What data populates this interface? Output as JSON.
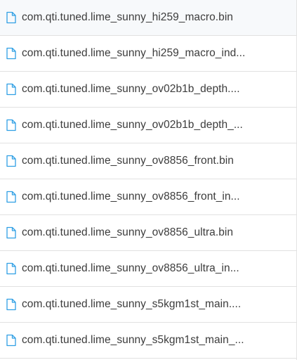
{
  "files": [
    {
      "name": "com.qti.tuned.lime_sunny_hi259_macro.bin",
      "icon": "file-icon"
    },
    {
      "name": "com.qti.tuned.lime_sunny_hi259_macro_ind...",
      "icon": "file-icon"
    },
    {
      "name": "com.qti.tuned.lime_sunny_ov02b1b_depth....",
      "icon": "file-icon"
    },
    {
      "name": "com.qti.tuned.lime_sunny_ov02b1b_depth_...",
      "icon": "file-icon"
    },
    {
      "name": "com.qti.tuned.lime_sunny_ov8856_front.bin",
      "icon": "file-icon"
    },
    {
      "name": "com.qti.tuned.lime_sunny_ov8856_front_in...",
      "icon": "file-icon"
    },
    {
      "name": "com.qti.tuned.lime_sunny_ov8856_ultra.bin",
      "icon": "file-icon"
    },
    {
      "name": "com.qti.tuned.lime_sunny_ov8856_ultra_in...",
      "icon": "file-icon"
    },
    {
      "name": "com.qti.tuned.lime_sunny_s5kgm1st_main....",
      "icon": "file-icon"
    },
    {
      "name": "com.qti.tuned.lime_sunny_s5kgm1st_main_...",
      "icon": "file-icon"
    }
  ],
  "colors": {
    "icon": "#2f9fe4",
    "text": "#3c3c3c",
    "divider": "#e1e1e1"
  }
}
